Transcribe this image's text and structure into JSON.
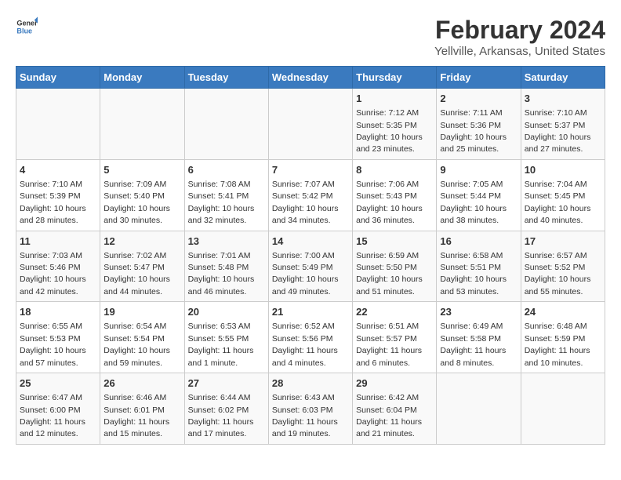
{
  "logo": {
    "line1": "General",
    "line2": "Blue"
  },
  "title": "February 2024",
  "subtitle": "Yellville, Arkansas, United States",
  "days_of_week": [
    "Sunday",
    "Monday",
    "Tuesday",
    "Wednesday",
    "Thursday",
    "Friday",
    "Saturday"
  ],
  "weeks": [
    [
      {
        "day": "",
        "content": ""
      },
      {
        "day": "",
        "content": ""
      },
      {
        "day": "",
        "content": ""
      },
      {
        "day": "",
        "content": ""
      },
      {
        "day": "1",
        "content": "Sunrise: 7:12 AM\nSunset: 5:35 PM\nDaylight: 10 hours and 23 minutes."
      },
      {
        "day": "2",
        "content": "Sunrise: 7:11 AM\nSunset: 5:36 PM\nDaylight: 10 hours and 25 minutes."
      },
      {
        "day": "3",
        "content": "Sunrise: 7:10 AM\nSunset: 5:37 PM\nDaylight: 10 hours and 27 minutes."
      }
    ],
    [
      {
        "day": "4",
        "content": "Sunrise: 7:10 AM\nSunset: 5:39 PM\nDaylight: 10 hours and 28 minutes."
      },
      {
        "day": "5",
        "content": "Sunrise: 7:09 AM\nSunset: 5:40 PM\nDaylight: 10 hours and 30 minutes."
      },
      {
        "day": "6",
        "content": "Sunrise: 7:08 AM\nSunset: 5:41 PM\nDaylight: 10 hours and 32 minutes."
      },
      {
        "day": "7",
        "content": "Sunrise: 7:07 AM\nSunset: 5:42 PM\nDaylight: 10 hours and 34 minutes."
      },
      {
        "day": "8",
        "content": "Sunrise: 7:06 AM\nSunset: 5:43 PM\nDaylight: 10 hours and 36 minutes."
      },
      {
        "day": "9",
        "content": "Sunrise: 7:05 AM\nSunset: 5:44 PM\nDaylight: 10 hours and 38 minutes."
      },
      {
        "day": "10",
        "content": "Sunrise: 7:04 AM\nSunset: 5:45 PM\nDaylight: 10 hours and 40 minutes."
      }
    ],
    [
      {
        "day": "11",
        "content": "Sunrise: 7:03 AM\nSunset: 5:46 PM\nDaylight: 10 hours and 42 minutes."
      },
      {
        "day": "12",
        "content": "Sunrise: 7:02 AM\nSunset: 5:47 PM\nDaylight: 10 hours and 44 minutes."
      },
      {
        "day": "13",
        "content": "Sunrise: 7:01 AM\nSunset: 5:48 PM\nDaylight: 10 hours and 46 minutes."
      },
      {
        "day": "14",
        "content": "Sunrise: 7:00 AM\nSunset: 5:49 PM\nDaylight: 10 hours and 49 minutes."
      },
      {
        "day": "15",
        "content": "Sunrise: 6:59 AM\nSunset: 5:50 PM\nDaylight: 10 hours and 51 minutes."
      },
      {
        "day": "16",
        "content": "Sunrise: 6:58 AM\nSunset: 5:51 PM\nDaylight: 10 hours and 53 minutes."
      },
      {
        "day": "17",
        "content": "Sunrise: 6:57 AM\nSunset: 5:52 PM\nDaylight: 10 hours and 55 minutes."
      }
    ],
    [
      {
        "day": "18",
        "content": "Sunrise: 6:55 AM\nSunset: 5:53 PM\nDaylight: 10 hours and 57 minutes."
      },
      {
        "day": "19",
        "content": "Sunrise: 6:54 AM\nSunset: 5:54 PM\nDaylight: 10 hours and 59 minutes."
      },
      {
        "day": "20",
        "content": "Sunrise: 6:53 AM\nSunset: 5:55 PM\nDaylight: 11 hours and 1 minute."
      },
      {
        "day": "21",
        "content": "Sunrise: 6:52 AM\nSunset: 5:56 PM\nDaylight: 11 hours and 4 minutes."
      },
      {
        "day": "22",
        "content": "Sunrise: 6:51 AM\nSunset: 5:57 PM\nDaylight: 11 hours and 6 minutes."
      },
      {
        "day": "23",
        "content": "Sunrise: 6:49 AM\nSunset: 5:58 PM\nDaylight: 11 hours and 8 minutes."
      },
      {
        "day": "24",
        "content": "Sunrise: 6:48 AM\nSunset: 5:59 PM\nDaylight: 11 hours and 10 minutes."
      }
    ],
    [
      {
        "day": "25",
        "content": "Sunrise: 6:47 AM\nSunset: 6:00 PM\nDaylight: 11 hours and 12 minutes."
      },
      {
        "day": "26",
        "content": "Sunrise: 6:46 AM\nSunset: 6:01 PM\nDaylight: 11 hours and 15 minutes."
      },
      {
        "day": "27",
        "content": "Sunrise: 6:44 AM\nSunset: 6:02 PM\nDaylight: 11 hours and 17 minutes."
      },
      {
        "day": "28",
        "content": "Sunrise: 6:43 AM\nSunset: 6:03 PM\nDaylight: 11 hours and 19 minutes."
      },
      {
        "day": "29",
        "content": "Sunrise: 6:42 AM\nSunset: 6:04 PM\nDaylight: 11 hours and 21 minutes."
      },
      {
        "day": "",
        "content": ""
      },
      {
        "day": "",
        "content": ""
      }
    ]
  ]
}
